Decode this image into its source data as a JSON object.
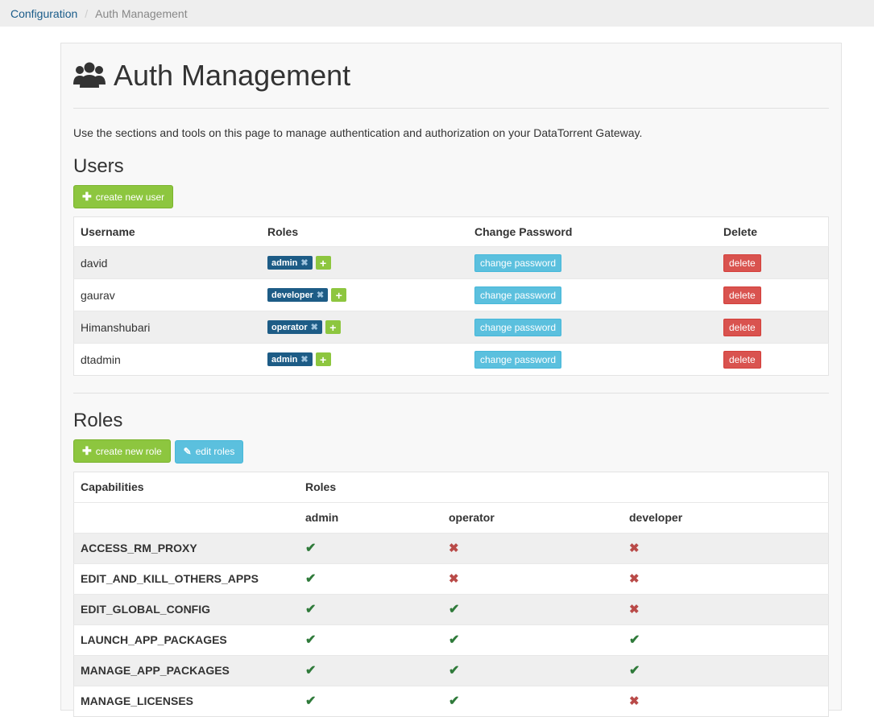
{
  "breadcrumb": {
    "parent": "Configuration",
    "current": "Auth Management"
  },
  "page": {
    "title": "Auth Management",
    "intro": "Use the sections and tools on this page to manage authentication and authorization on your DataTorrent Gateway."
  },
  "users": {
    "heading": "Users",
    "create_label": "create new user",
    "columns": [
      "Username",
      "Roles",
      "Change Password",
      "Delete"
    ],
    "change_password_label": "change password",
    "delete_label": "delete",
    "rows": [
      {
        "username": "david",
        "role": "admin"
      },
      {
        "username": "gaurav",
        "role": "developer"
      },
      {
        "username": "Himanshubari",
        "role": "operator"
      },
      {
        "username": "dtadmin",
        "role": "admin"
      }
    ]
  },
  "roles": {
    "heading": "Roles",
    "create_label": "create new role",
    "edit_label": "edit roles",
    "col_capabilities": "Capabilities",
    "col_roles": "Roles",
    "role_names": [
      "admin",
      "operator",
      "developer"
    ],
    "capabilities": [
      {
        "name": "ACCESS_RM_PROXY",
        "admin": true,
        "operator": false,
        "developer": false
      },
      {
        "name": "EDIT_AND_KILL_OTHERS_APPS",
        "admin": true,
        "operator": false,
        "developer": false
      },
      {
        "name": "EDIT_GLOBAL_CONFIG",
        "admin": true,
        "operator": true,
        "developer": false
      },
      {
        "name": "LAUNCH_APP_PACKAGES",
        "admin": true,
        "operator": true,
        "developer": true
      },
      {
        "name": "MANAGE_APP_PACKAGES",
        "admin": true,
        "operator": true,
        "developer": true
      },
      {
        "name": "MANAGE_LICENSES",
        "admin": true,
        "operator": true,
        "developer": false
      }
    ]
  },
  "colors": {
    "accent_green": "#8dc63f",
    "info_blue": "#5bc0de",
    "danger_red": "#d9534f",
    "tag_blue": "#1d5c86"
  },
  "icons": {
    "header": "users-icon",
    "create": "plus-icon",
    "edit": "pencil-icon",
    "allowed": "check-icon",
    "denied": "cross-icon"
  }
}
